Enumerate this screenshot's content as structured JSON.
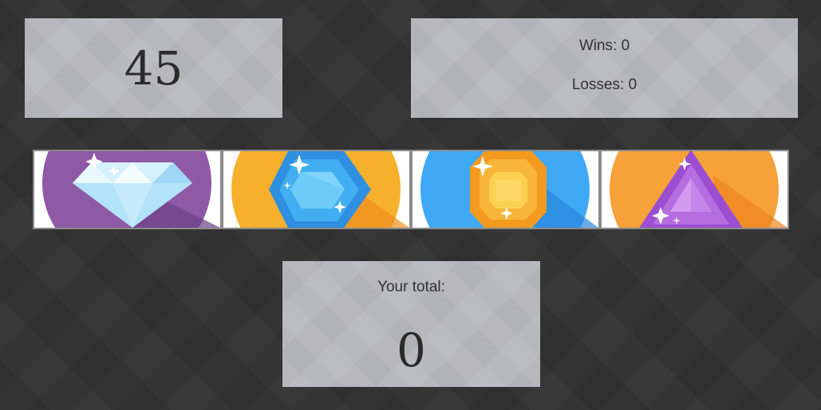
{
  "target": {
    "value": "45"
  },
  "scoreboard": {
    "wins_text": "Wins: 0",
    "losses_text": "Losses: 0"
  },
  "gems": [
    {
      "name": "diamond",
      "icon": "diamond-icon",
      "bg_color": "#8e5aa6",
      "gem_color": "#cfeeff"
    },
    {
      "name": "blue-hexagon",
      "icon": "blue-gem-icon",
      "bg_color": "#f6b02c",
      "gem_color": "#3aa3e8"
    },
    {
      "name": "yellow-octagon",
      "icon": "yellow-gem-icon",
      "bg_color": "#3fa9f5",
      "gem_color": "#f7b53a"
    },
    {
      "name": "purple-triangle",
      "icon": "purple-gem-icon",
      "bg_color": "#f6a13a",
      "gem_color": "#b56de0"
    }
  ],
  "total": {
    "label": "Your total:",
    "value": "0"
  }
}
